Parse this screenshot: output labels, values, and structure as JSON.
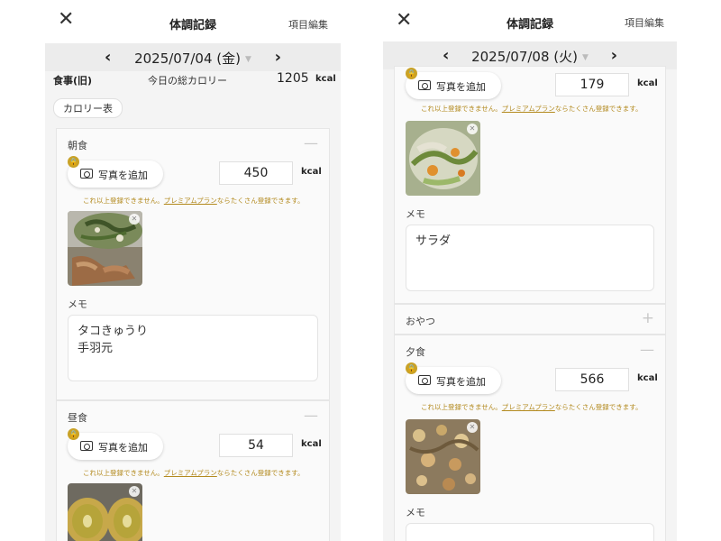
{
  "common": {
    "title": "体調記録",
    "edit": "項目編集",
    "add_photo": "写真を追加",
    "kcal": "kcal",
    "memo_label": "メモ",
    "notice_pre": "これ以上登録できません。",
    "notice_link": "プレミアムプラン",
    "notice_post": "ならたくさん登録できます。"
  },
  "screen1": {
    "date": "2025/07/04 (金)",
    "meal_label": "食事(旧)",
    "total_label": "今日の総カロリー",
    "total_value": "1205",
    "calorie_table": "カロリー表",
    "breakfast": {
      "name": "朝食",
      "kcal": "450",
      "memo_line1": "タコきゅうり",
      "memo_line2": "手羽元"
    },
    "lunch": {
      "name": "昼食",
      "kcal": "54"
    }
  },
  "screen2": {
    "date": "2025/07/08 (火)",
    "first": {
      "kcal": "179",
      "memo": "サラダ"
    },
    "snack": {
      "name": "おやつ"
    },
    "dinner": {
      "name": "夕食",
      "kcal": "566"
    }
  }
}
